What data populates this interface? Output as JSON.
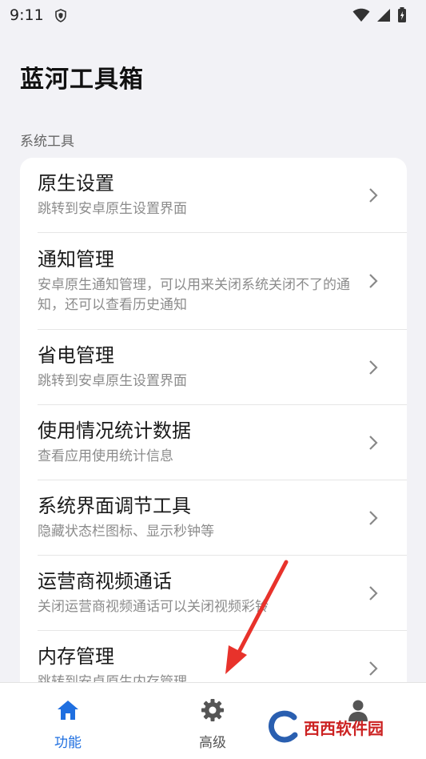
{
  "status_bar": {
    "time": "9:11"
  },
  "app_title": "蓝河工具箱",
  "section_label": "系统工具",
  "items": [
    {
      "title": "原生设置",
      "desc": "跳转到安卓原生设置界面"
    },
    {
      "title": "通知管理",
      "desc": "安卓原生通知管理，可以用来关闭系统关闭不了的通知，还可以查看历史通知"
    },
    {
      "title": "省电管理",
      "desc": "跳转到安卓原生设置界面"
    },
    {
      "title": "使用情况统计数据",
      "desc": "查看应用使用统计信息"
    },
    {
      "title": "系统界面调节工具",
      "desc": "隐藏状态栏图标、显示秒钟等"
    },
    {
      "title": "运营商视频通话",
      "desc": "关闭运营商视频通话可以关闭视频彩铃"
    },
    {
      "title": "内存管理",
      "desc": "跳转到安卓原生内存管理"
    }
  ],
  "nav": {
    "features_label": "功能",
    "advanced_label": "高级",
    "active_color": "#1f6fe0",
    "inactive_color": "#555555"
  },
  "watermark": {
    "text": "西西软件园"
  },
  "icons": [
    "shield-icon",
    "wifi-icon",
    "signal-icon",
    "battery-icon",
    "chevron-right-icon",
    "home-icon",
    "gear-icon",
    "person-icon",
    "red-arrow"
  ]
}
